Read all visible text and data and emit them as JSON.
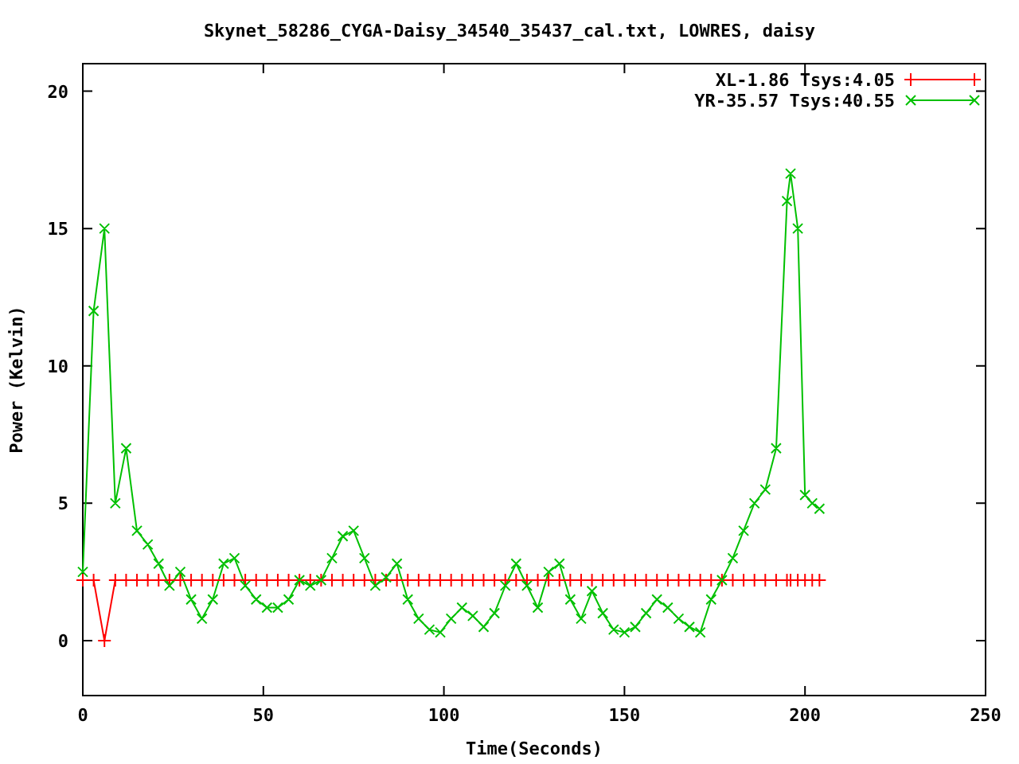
{
  "chart": {
    "chart_data": {
      "type": "line",
      "title": "Skynet_58286_CYGA-Daisy_34540_35437_cal.txt, LOWRES, daisy",
      "xlabel": "Time(Seconds)",
      "ylabel": "Power (Kelvin)",
      "x": [
        0,
        3,
        6,
        9,
        12,
        15,
        18,
        21,
        24,
        27,
        30,
        33,
        36,
        39,
        42,
        45,
        48,
        51,
        54,
        57,
        60,
        63,
        66,
        69,
        72,
        75,
        78,
        81,
        84,
        87,
        90,
        93,
        96,
        99,
        102,
        105,
        108,
        111,
        114,
        117,
        120,
        123,
        126,
        129,
        132,
        135,
        138,
        141,
        144,
        147,
        150,
        153,
        156,
        159,
        162,
        165,
        168,
        171,
        174,
        177,
        180,
        183,
        186,
        189,
        192,
        195,
        196,
        198,
        200,
        202,
        204
      ],
      "series": [
        {
          "name": "XL-1.86 Tsys:4.05",
          "color": "#ff0000",
          "marker": "plus",
          "values": [
            2.2,
            2.2,
            0,
            2.2,
            2.2,
            2.2,
            2.2,
            2.2,
            2.2,
            2.2,
            2.2,
            2.2,
            2.2,
            2.2,
            2.2,
            2.2,
            2.2,
            2.2,
            2.2,
            2.2,
            2.2,
            2.2,
            2.2,
            2.2,
            2.2,
            2.2,
            2.2,
            2.2,
            2.2,
            2.2,
            2.2,
            2.2,
            2.2,
            2.2,
            2.2,
            2.2,
            2.2,
            2.2,
            2.2,
            2.2,
            2.2,
            2.2,
            2.2,
            2.2,
            2.2,
            2.2,
            2.2,
            2.2,
            2.2,
            2.2,
            2.2,
            2.2,
            2.2,
            2.2,
            2.2,
            2.2,
            2.2,
            2.2,
            2.2,
            2.2,
            2.2,
            2.2,
            2.2,
            2.2,
            2.2,
            2.2,
            2.2,
            2.2,
            2.2,
            2.2,
            2.2
          ]
        },
        {
          "name": "YR-35.57 Tsys:40.55",
          "color": "#00c000",
          "marker": "cross",
          "values": [
            2.5,
            12,
            15,
            5,
            7,
            4,
            3.5,
            2.8,
            2,
            2.5,
            1.5,
            0.8,
            1.5,
            2.8,
            3,
            2,
            1.5,
            1.2,
            1.2,
            1.5,
            2.2,
            2,
            2.2,
            3,
            3.8,
            4,
            3,
            2,
            2.3,
            2.8,
            1.5,
            0.8,
            0.4,
            0.3,
            0.8,
            1.2,
            0.9,
            0.5,
            1,
            2,
            2.8,
            2,
            1.2,
            2.5,
            2.8,
            1.5,
            0.8,
            1.8,
            1,
            0.4,
            0.3,
            0.5,
            1,
            1.5,
            1.2,
            0.8,
            0.5,
            0.3,
            1.5,
            2.2,
            3,
            4,
            5,
            5.5,
            7,
            16,
            17,
            15,
            5.3,
            5,
            4.8
          ]
        }
      ],
      "legend": true,
      "xlim": [
        0,
        250
      ],
      "ylim": [
        -2,
        21
      ],
      "xticks": [
        0,
        50,
        100,
        150,
        200,
        250
      ],
      "yticks": [
        0,
        5,
        10,
        15,
        20
      ]
    }
  }
}
